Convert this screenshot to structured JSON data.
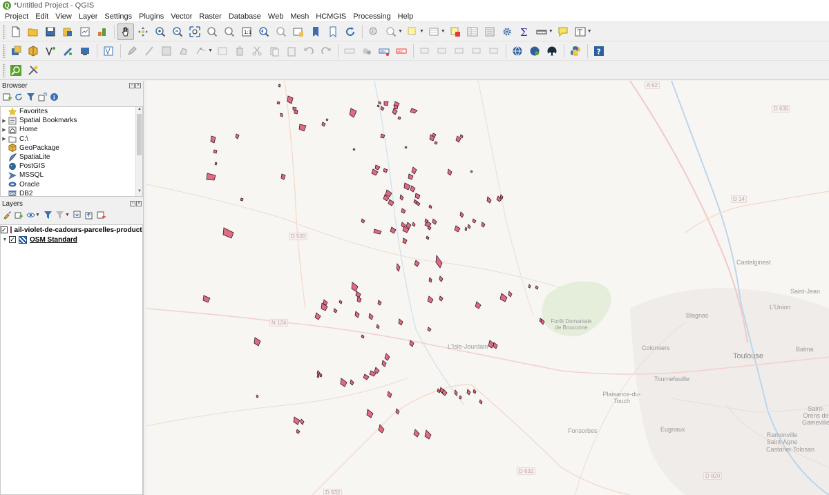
{
  "window": {
    "title": "*Untitled Project - QGIS"
  },
  "menu": [
    "Project",
    "Edit",
    "View",
    "Layer",
    "Settings",
    "Plugins",
    "Vector",
    "Raster",
    "Database",
    "Web",
    "Mesh",
    "HCMGIS",
    "Processing",
    "Help"
  ],
  "browser": {
    "title": "Browser",
    "items": [
      {
        "label": "Favorites",
        "icon": "star-icon",
        "expandable": false
      },
      {
        "label": "Spatial Bookmarks",
        "icon": "bookmark-icon",
        "expandable": true
      },
      {
        "label": "Home",
        "icon": "home-folder-icon",
        "expandable": true
      },
      {
        "label": "C:\\",
        "icon": "drive-folder-icon",
        "expandable": true
      },
      {
        "label": "GeoPackage",
        "icon": "geopackage-icon",
        "expandable": false
      },
      {
        "label": "SpatiaLite",
        "icon": "spatialite-icon",
        "expandable": false
      },
      {
        "label": "PostGIS",
        "icon": "postgis-icon",
        "expandable": false
      },
      {
        "label": "MSSQL",
        "icon": "mssql-icon",
        "expandable": false
      },
      {
        "label": "Oracle",
        "icon": "oracle-icon",
        "expandable": false
      },
      {
        "label": "DB2",
        "icon": "db2-icon",
        "expandable": false
      }
    ]
  },
  "layers": {
    "title": "Layers",
    "items": [
      {
        "label": "ail-violet-de-cadours-parcelles-producti",
        "checked": true,
        "type": "polygon",
        "color": "#e06b84"
      },
      {
        "label": "OSM Standard",
        "checked": true,
        "type": "raster"
      }
    ]
  },
  "map": {
    "road_labels": [
      "A 62",
      "D 630",
      "D 14",
      "D 520",
      "N 124",
      "D 632",
      "D 820",
      "D 632"
    ],
    "places": [
      "Castelginest",
      "Saint-Jean",
      "L'Union",
      "Blagnac",
      "Colomiers",
      "Balma",
      "Tournefeuille",
      "Plaisance-du-Touch",
      "Fonsorbes",
      "Eugnaux",
      "Ramonville Saint-Agne",
      "Saint-Orens de Gameville",
      "Castanet-Tolosan",
      "L'Isle-Jourdain",
      "Forêt Domaniale de Bouconne"
    ],
    "city": "Toulouse",
    "parcel_color": "#e06b84"
  }
}
